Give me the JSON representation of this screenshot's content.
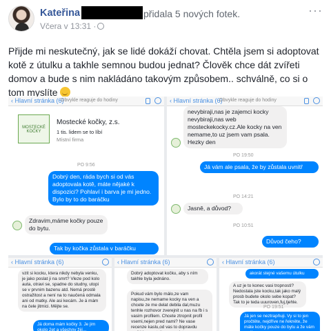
{
  "post": {
    "author": "Kateřina",
    "action": "přidala 5 nových fotek.",
    "timestamp": "Včera v 13:31 ·",
    "more_label": "···",
    "text": "Přijde mi neskutečný, jak se lidé dokáží chovat. Chtěla jsem si adoptovat kotě z útulku a takhle semnou budou jednat? Člověk chce dát zvířeti domov a bude s nim nakládáno takovým způsobem.. schválně, co si o tom myslíte"
  },
  "photos": {
    "shot1": {
      "back_label": "‹ Hlavní stránka (6)",
      "sub_label": "Obvykle reaguje do hodiny",
      "page_name": "Mostecké kočky, z.s.",
      "page_likes": "1 tis. lidem se to líbí",
      "page_type": "Místní firma",
      "logo_text": "MOSTECKÉ KOČKY",
      "time1": "PO 9:56",
      "msg_out1": "Dobrý den, ráda bych si od vás adoptovala kotě, máte nějaké k dispozici? Pohlaví i barva je mi jedno. Bylo by to do baráčku",
      "msg_in1": "Zdravim,máme kočky pouze do bytu.",
      "msg_out2": "Tak by kočka zůstala v baráčku"
    },
    "shot2": {
      "back_label": "‹ Hlavní stránka (6)",
      "sub_label": "Obvykle reaguje do hodiny",
      "msg_in_top": "nevybiraji,nas je zajemci kocky nevybiraji,nas web mosteckekocky.cz.Ale kocky na ven nemame,to uz jsem vam psala. Hezky den",
      "time1": "PO 19:50",
      "msg_out1": "Já vám ale psala, že by zůstala uvnitř",
      "msg_in1": "Jasně, a důvod?",
      "time2": "PO 14:21",
      "time3": "PO 10:51",
      "msg_out2": "Důvod čeho?"
    },
    "shot3": {
      "back_label": "‹ Hlavní stránka (6)",
      "msg_in": "vzit si kocku, ktera nikdy nebyla venku, je jako poslat ji na smrt? Vleze pod kolo auta, otravi se, spadne do studny, utopi se v prvnim bazenu atd. Nemá prostě ostražitost a není na to naučená odmala ani od matky. Ale asi kecám. Je á mám na čele jitmici. Mějte se.",
      "msg_out": "Já doma mám kočky 3. Je jim okolo 2et a všechny žijí..."
    },
    "shot4": {
      "back_label": "‹ Hlavní stránka (6)",
      "msg_in_top": "Dobrý adoptovat kočku, aby s ním takhle byla jednáno.",
      "msg_in": "Pokud vám bylo málo,ze vam napisu,ze nemame kocky na ven a chcete ze me delat debila dal,muzu tenhle rozhovor zverejnit u nas na fb i s vasim profilem. Chcete ztropnit profil vsemi,nejen pred nami? Ne vase recenze kaslu,od vas to dopravdu sedi.Vzpamatujte se a zdete"
    },
    "shot5": {
      "back_label": "‹ Hlavní stránka (6)",
      "msg_out_top": "akorát stejné vašemu útulku",
      "msg_in": "A uz je to konec vasi tropnosti? Nedostala jste kocku,tak jako malý prosb budete okolo sebe kopat? Tak to je teda uuuroven,fuj,tjehle.",
      "time1": "PO 19:51",
      "msg_out": "Já jen se neztrapňuji. Vy si to jen pročtěte, nejdříve ne řekněte, že máte kočky pouze do bytu a že vám vadí"
    }
  },
  "colors": {
    "link": "#365899",
    "messenger_blue": "#0084ff",
    "incoming_bubble": "#f1f0f0"
  }
}
